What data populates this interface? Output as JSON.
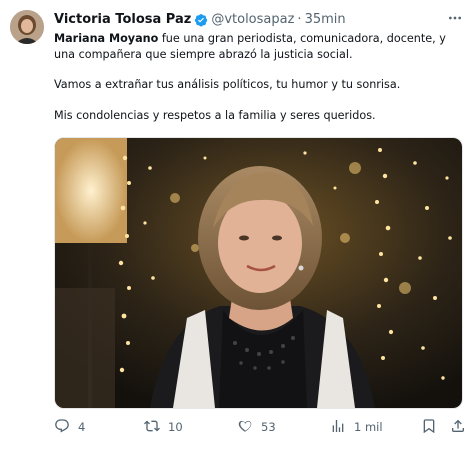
{
  "tweet": {
    "author_name": "Victoria Tolosa Paz",
    "handle": "@vtolosapaz",
    "separator": "·",
    "time": "35min",
    "bold_name": "Mariana Moyano",
    "line1_rest": " fue una gran periodista, comunicadora, docente, y una compañera que siempre abrazó la justicia social.",
    "line2": "Vamos a extrañar tus análisis políticos, tu humor y tu sonrisa.",
    "line3": "Mis condolencias y respetos a la familia y seres queridos."
  },
  "actions": {
    "replies": "4",
    "retweets": "10",
    "likes": "53",
    "views": "1 mil"
  },
  "icons": {
    "verified": "verified-badge-icon",
    "more": "more-options-icon",
    "reply": "reply-icon",
    "retweet": "retweet-icon",
    "like": "heart-icon",
    "views": "views-chart-icon",
    "bookmark": "bookmark-icon",
    "share": "share-icon"
  },
  "colors": {
    "text": "#0f1419",
    "secondary": "#536471",
    "verified": "#1d9bf0"
  }
}
